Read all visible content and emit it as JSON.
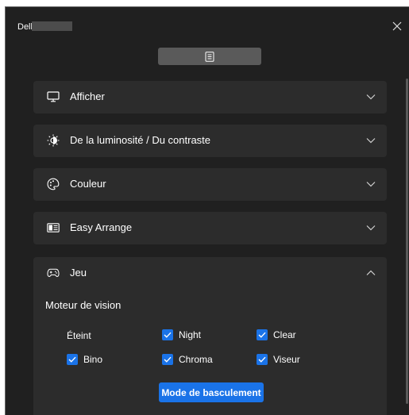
{
  "window": {
    "app_name": "Dell"
  },
  "icons": {
    "close": "close-icon",
    "menu": "menu-list-icon",
    "display": "monitor-icon",
    "brightness": "brightness-icon",
    "color": "palette-icon",
    "arrange": "easy-arrange-icon",
    "game": "gamepad-icon",
    "chevron_down": "chevron-down-icon",
    "chevron_up": "chevron-up-icon",
    "check": "check-icon"
  },
  "colors": {
    "background": "#202020",
    "panel": "#2c2c2c",
    "accent": "#1a73e8",
    "toolbar_button": "#5a5a5a"
  },
  "sections": [
    {
      "label": "Afficher",
      "expanded": false
    },
    {
      "label": "De la luminosité / Du contraste",
      "expanded": false
    },
    {
      "label": "Couleur",
      "expanded": false
    },
    {
      "label": "Easy Arrange",
      "expanded": false
    }
  ],
  "game": {
    "label": "Jeu",
    "expanded": true,
    "subtitle": "Moteur de vision",
    "off_label": "Éteint",
    "options": [
      {
        "label": "Night",
        "checked": true
      },
      {
        "label": "Clear",
        "checked": true
      },
      {
        "label": "Bino",
        "checked": true
      },
      {
        "label": "Chroma",
        "checked": true
      },
      {
        "label": "Viseur",
        "checked": true
      }
    ],
    "toggle_button": "Mode de basculement"
  }
}
